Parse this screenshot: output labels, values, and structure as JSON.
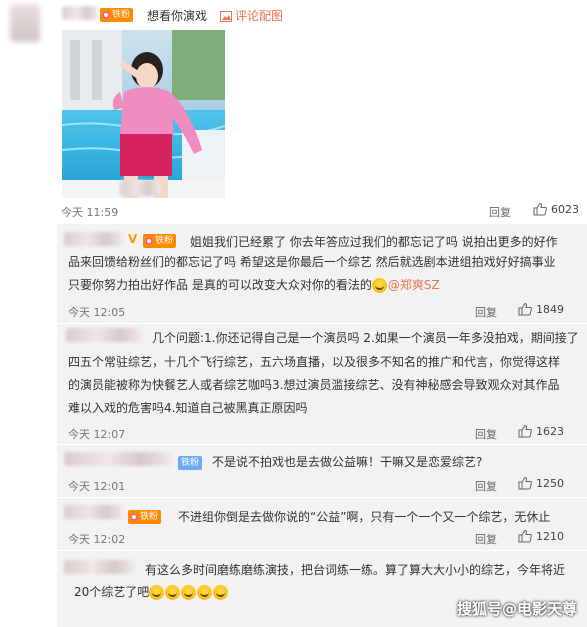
{
  "top": {
    "badge_label": "铁粉",
    "text": "想看你演戏",
    "image_link": "评论配图"
  },
  "first": {
    "time": "今天 11:59",
    "reply": "回复",
    "likes": "6023"
  },
  "comments": [
    {
      "badge_label": "铁粉",
      "text1": "姐姐我们已经累了 你去年答应过我们的都忘记了吗 说拍出更多的好作",
      "text2": "品来回馈给粉丝们的都忘记了吗 希望这是你最后一个综艺 然后就选剧本进组拍戏好好搞事业",
      "text3": "只要你努力拍出好作品 是真的可以改变大众对你的看法的",
      "mention": "@郑爽SZ",
      "time": "今天 12:05",
      "reply": "回复",
      "likes": "1849"
    },
    {
      "text1": "几个问题:1.你还记得自己是一个演员吗 2.如果一个演员一年多没拍戏，期间接了",
      "text2": "四五个常驻综艺，十几个飞行综艺，五六场直播，以及很多不知名的推广和代言，你觉得这样",
      "text3": "的演员能被称为快餐艺人或者综艺咖吗3.想过演员滥接综艺、没有神秘感会导致观众对其作品",
      "text4": "难以入戏的危害吗4.知道自己被黑真正原因吗",
      "time": "今天 12:07",
      "reply": "回复",
      "likes": "1623"
    },
    {
      "badge_label": "铁粉",
      "text": "不是说不拍戏也是去做公益嘛！干嘛又是恋爱综艺?",
      "time": "今天 12:01",
      "reply": "回复",
      "likes": "1250"
    },
    {
      "badge_label": "铁粉",
      "text": "不进组你倒是去做你说的“公益”啊，只有一个一个又一个综艺，无休止",
      "time": "今天 12:02",
      "reply": "回复",
      "likes": "1210"
    },
    {
      "text1": "有这么多时间磨练磨练演技，把台词练一练。算了算大大小小的综艺，今年将近",
      "text2": "20个综艺了吧"
    }
  ],
  "watermark": "搜狐号@电影天尊"
}
